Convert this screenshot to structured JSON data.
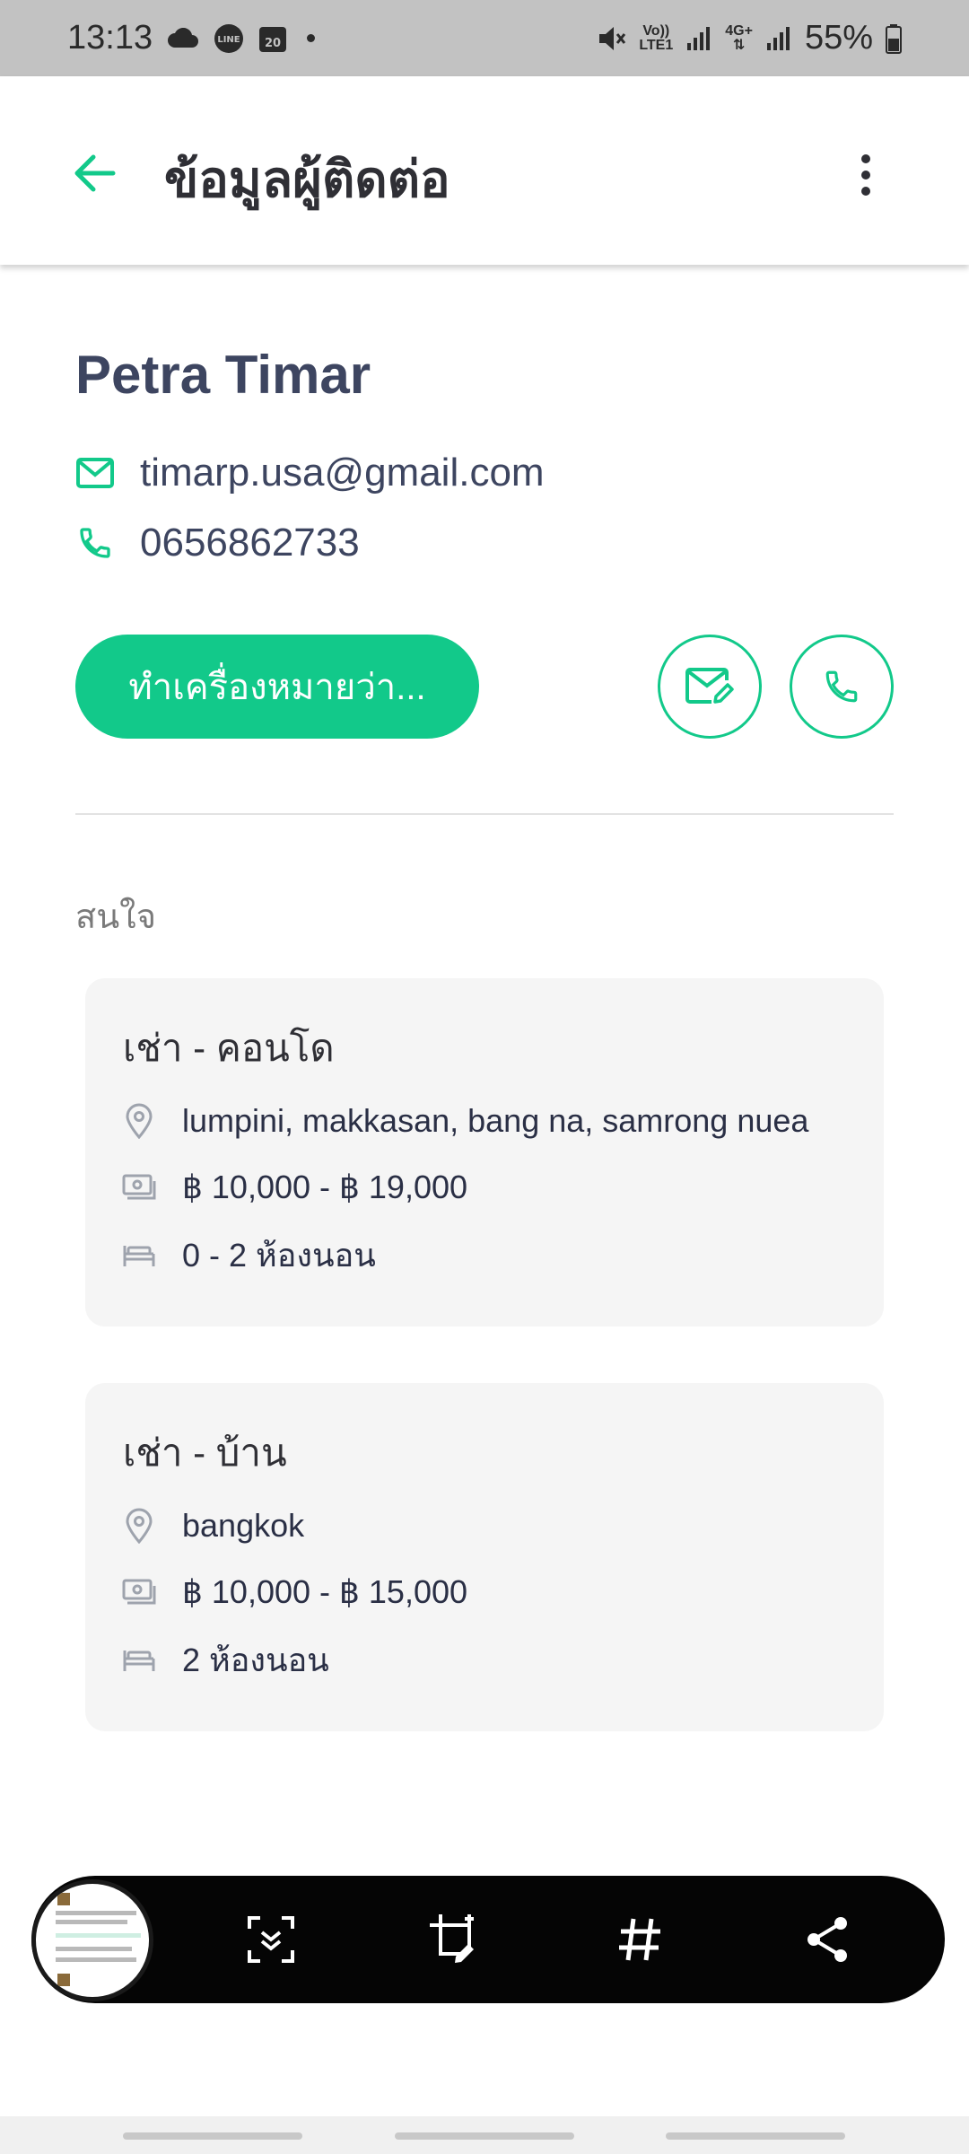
{
  "status_bar": {
    "time": "13:13",
    "calendar_day": "20",
    "line_label": "LINE",
    "volte_label": "Vo)) LTE1",
    "net_label": "4G+",
    "battery": "55%"
  },
  "app_bar": {
    "title": "ข้อมูลผู้ติดต่อ"
  },
  "contact": {
    "name": "Petra Timar",
    "email": "timarp.usa@gmail.com",
    "phone": "0656862733"
  },
  "actions": {
    "primary_label": "ทำเครื่องหมายว่า..."
  },
  "interests": {
    "section_label": "สนใจ",
    "cards": [
      {
        "title": "เช่า - คอนโด",
        "location": "lumpini, makkasan, bang na, samrong nuea",
        "price": "฿ 10,000 - ฿ 19,000",
        "bedrooms": "0 - 2 ห้องนอน"
      },
      {
        "title": "เช่า - บ้าน",
        "location": "bangkok",
        "price": "฿ 10,000 - ฿ 15,000",
        "bedrooms": "2 ห้องนอน"
      }
    ]
  },
  "colors": {
    "accent": "#12c98a",
    "text_primary": "#3d4560",
    "card_bg": "#f5f5f5",
    "toolbar_bg": "#050505"
  },
  "icons": {
    "back": "arrow-left-icon",
    "more": "more-vertical-icon",
    "email": "mail-icon",
    "phone": "phone-icon",
    "compose_mail": "mail-edit-icon",
    "location": "map-pin-icon",
    "money": "banknote-icon",
    "bed": "bed-icon",
    "scroll_capture": "scroll-capture-icon",
    "crop_edit": "crop-edit-icon",
    "hashtag": "hashtag-icon",
    "share": "share-icon"
  }
}
